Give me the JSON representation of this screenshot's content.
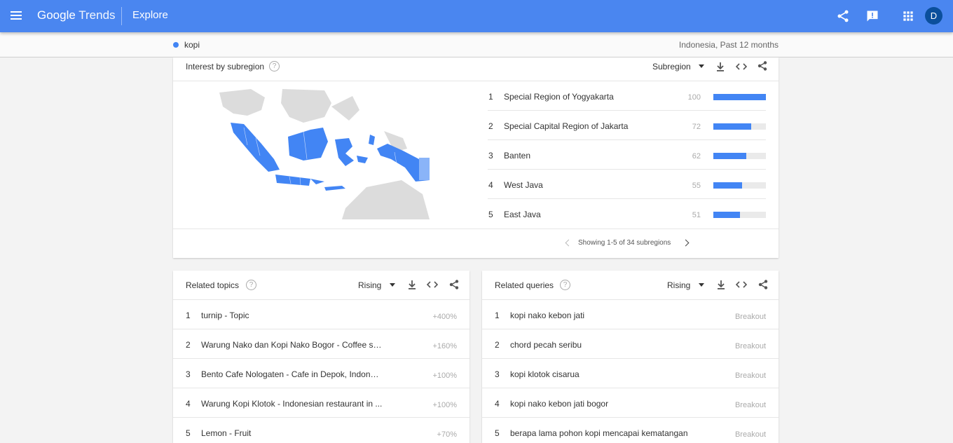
{
  "header": {
    "logo_brand": "Google",
    "logo_product": "Trends",
    "nav_title": "Explore",
    "avatar_initial": "D",
    "brand_color": "#4a86f0"
  },
  "search": {
    "term": "kopi",
    "term_color": "#4285f4",
    "scope": "Indonesia, Past 12 months"
  },
  "subregion": {
    "title": "Interest by subregion",
    "dropdown_value": "Subregion",
    "rows": [
      {
        "rank": "1",
        "name": "Special Region of Yogyakarta",
        "value": "100",
        "score": 100
      },
      {
        "rank": "2",
        "name": "Special Capital Region of Jakarta",
        "value": "72",
        "score": 72
      },
      {
        "rank": "3",
        "name": "Banten",
        "value": "62",
        "score": 62
      },
      {
        "rank": "4",
        "name": "West Java",
        "value": "55",
        "score": 55
      },
      {
        "rank": "5",
        "name": "East Java",
        "value": "51",
        "score": 51
      }
    ],
    "pagination": "Showing 1-5 of 34 subregions"
  },
  "related_topics": {
    "title": "Related topics",
    "dropdown_value": "Rising",
    "rows": [
      {
        "rank": "1",
        "name": "turnip - Topic",
        "value": "+400%"
      },
      {
        "rank": "2",
        "name": "Warung Nako dan Kopi Nako Bogor - Coffee sh...",
        "value": "+160%"
      },
      {
        "rank": "3",
        "name": "Bento Cafe Nologaten - Cafe in Depok, Indones...",
        "value": "+100%"
      },
      {
        "rank": "4",
        "name": "Warung Kopi Klotok - Indonesian restaurant in ...",
        "value": "+100%"
      },
      {
        "rank": "5",
        "name": "Lemon - Fruit",
        "value": "+70%"
      }
    ]
  },
  "related_queries": {
    "title": "Related queries",
    "dropdown_value": "Rising",
    "rows": [
      {
        "rank": "1",
        "name": "kopi nako kebon jati",
        "value": "Breakout"
      },
      {
        "rank": "2",
        "name": "chord pecah seribu",
        "value": "Breakout"
      },
      {
        "rank": "3",
        "name": "kopi klotok cisarua",
        "value": "Breakout"
      },
      {
        "rank": "4",
        "name": "kopi nako kebon jati bogor",
        "value": "Breakout"
      },
      {
        "rank": "5",
        "name": "berapa lama pohon kopi mencapai kematangan",
        "value": "Breakout"
      }
    ]
  }
}
